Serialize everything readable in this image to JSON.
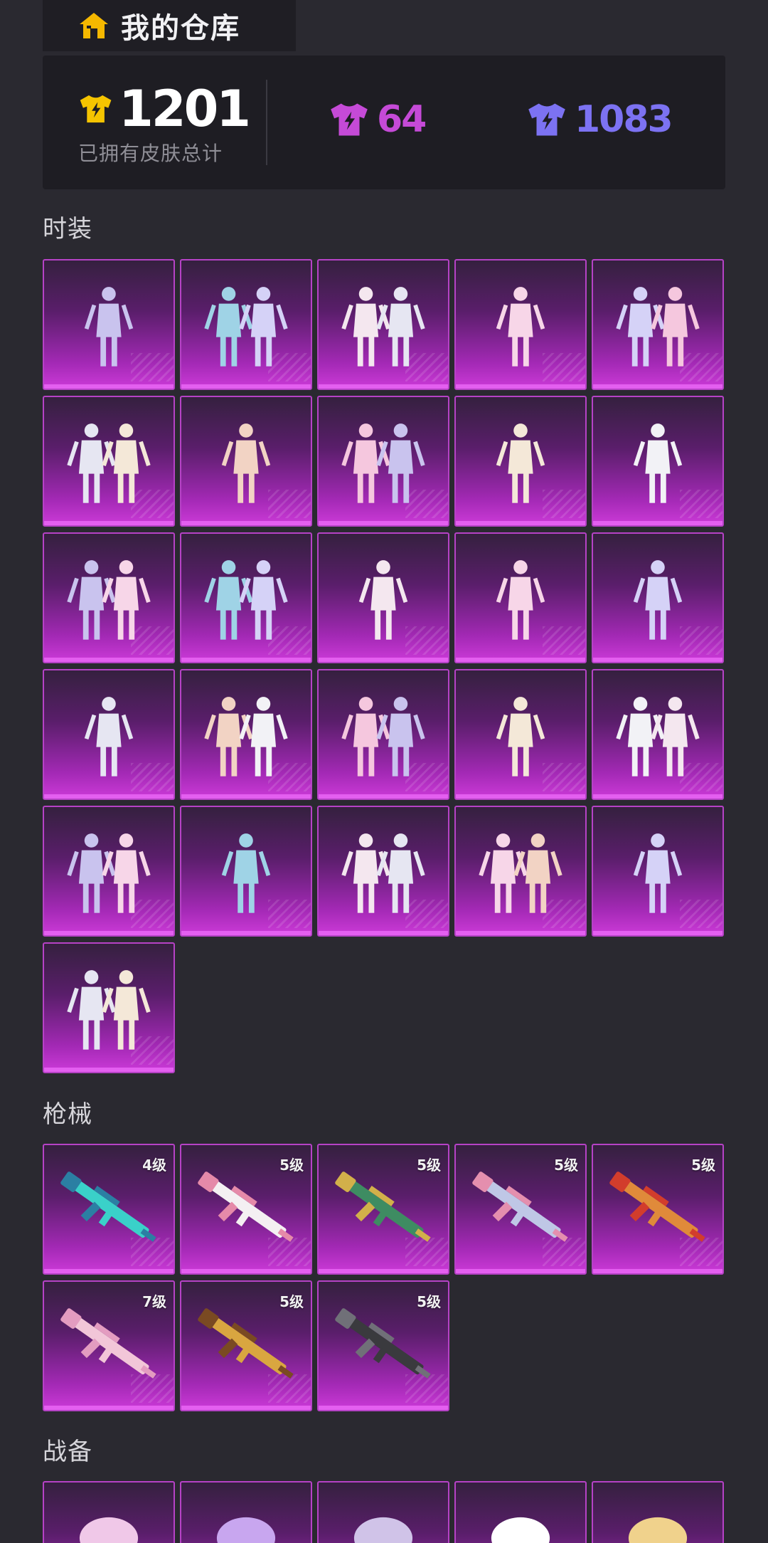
{
  "header": {
    "title": "我的仓库",
    "icon": "home-icon",
    "icon_color": "#f5b800"
  },
  "summary": {
    "total_count": "1201",
    "total_label": "已拥有皮肤总计",
    "purple_count": "64",
    "blue_count": "1083",
    "colors": {
      "gold": "#f5c400",
      "purple": "#c54ad7",
      "blue": "#7c72f2"
    }
  },
  "sections": {
    "fashion": {
      "title": "时装",
      "count": 26,
      "item_icon": "outfit-icon"
    },
    "weapons": {
      "title": "枪械",
      "item_icon": "rifle-icon",
      "levels": [
        "4级",
        "5级",
        "5级",
        "5级",
        "5级",
        "7级",
        "5级",
        "5级"
      ]
    },
    "gear": {
      "title": "战备",
      "count": 5,
      "item_icon": "gear-item-icon"
    }
  },
  "tile_colors": {
    "top": "#35203f",
    "bottom": "#cc3ad8",
    "border": "#b642c6"
  }
}
